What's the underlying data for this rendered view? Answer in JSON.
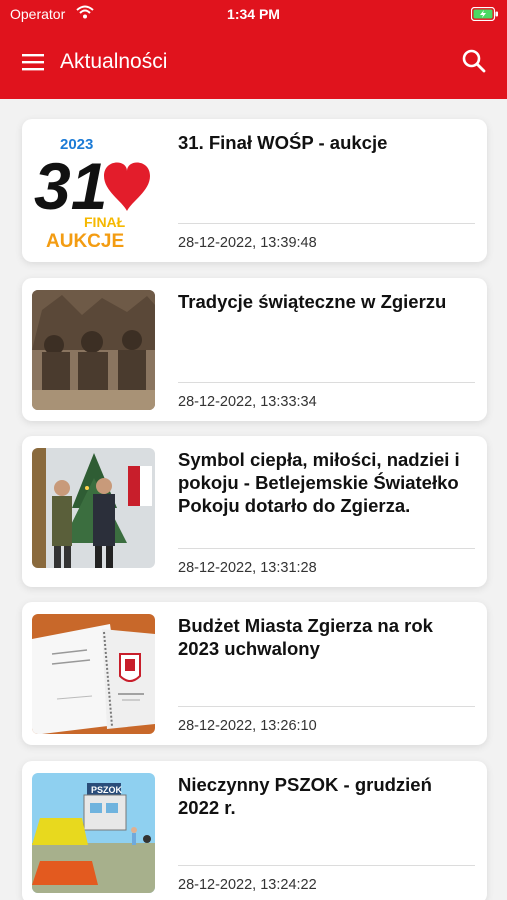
{
  "status_bar": {
    "carrier": "Operator",
    "time": "1:34 PM"
  },
  "app_bar": {
    "title": "Aktualności",
    "menu_icon": "hamburger-menu-icon",
    "search_icon": "search-icon",
    "color": "#e0131d"
  },
  "news": [
    {
      "title": "31. Finał WOŚP - aukcje",
      "date": "28-12-2022, 13:39:48",
      "thumb_icon": "wosp-aukcje-logo"
    },
    {
      "title": "Tradycje świąteczne w Zgierzu",
      "date": "28-12-2022, 13:33:34",
      "thumb_icon": "archival-photo"
    },
    {
      "title": "Symbol ciepła, miłości, nadziei i pokoju - Betlejemskie Światełko Pokoju dotarło do Zgierza.",
      "date": "28-12-2022, 13:31:28",
      "thumb_icon": "event-photo"
    },
    {
      "title": "Budżet Miasta Zgierza na rok 2023 uchwalony",
      "date": "28-12-2022, 13:26:10",
      "thumb_icon": "document-photo"
    },
    {
      "title": "Nieczynny PSZOK - grudzień 2022 r.",
      "date": "28-12-2022, 13:24:22",
      "thumb_icon": "pszok-illustration"
    }
  ],
  "thumb_text": {
    "wosp_year": "2023",
    "wosp_number": "31",
    "wosp_final": "FINAŁ",
    "wosp_aukcje": "AUKCJE",
    "pszok_sign": "PSZOK"
  }
}
